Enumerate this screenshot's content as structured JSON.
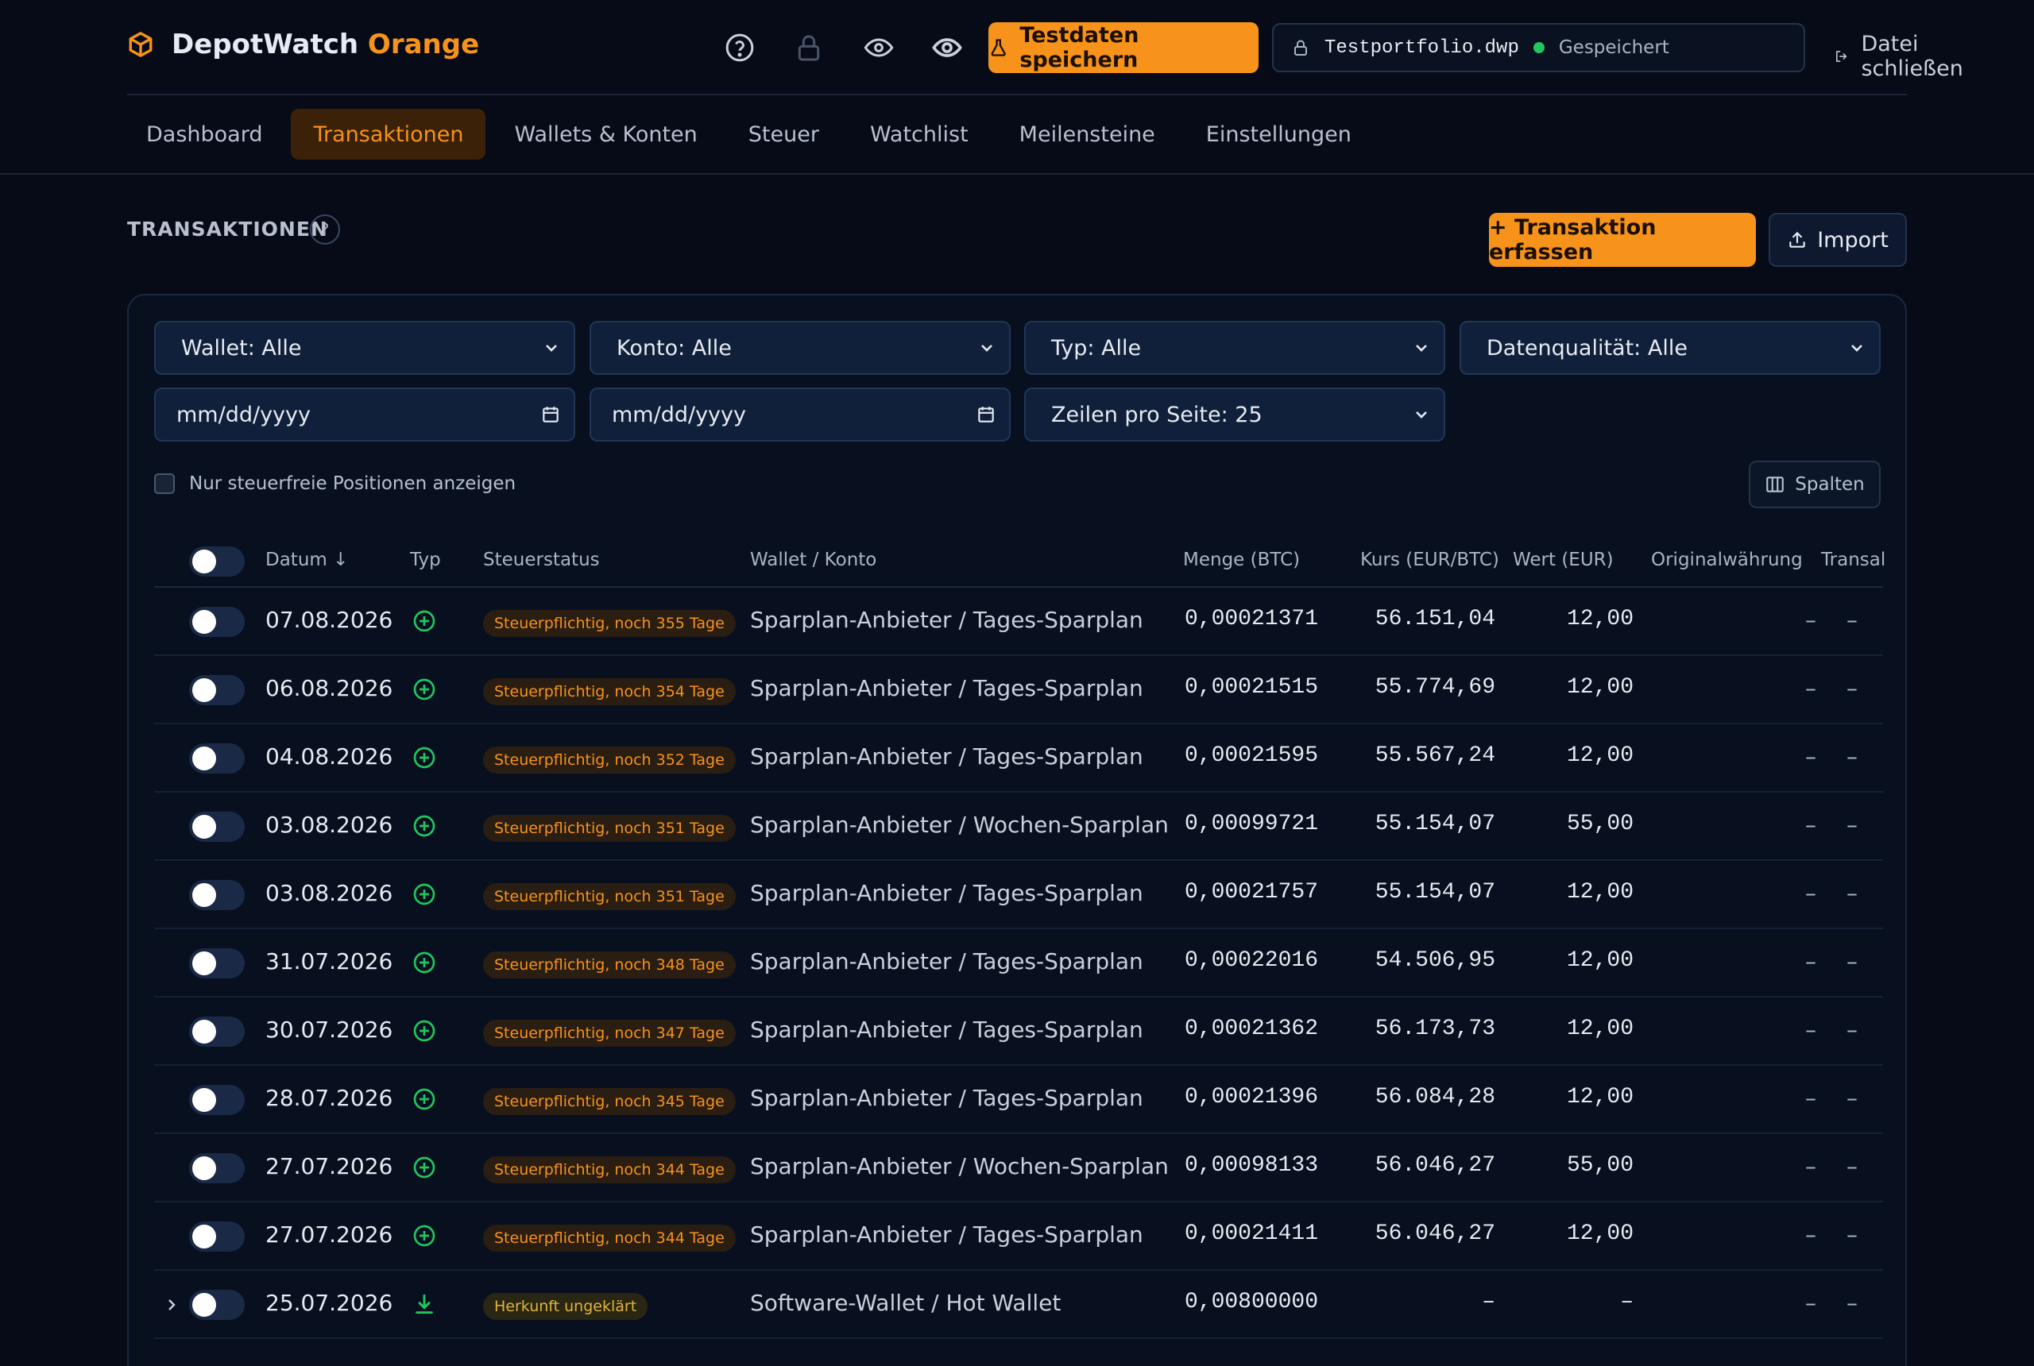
{
  "header": {
    "brand_main": "DepotWatch",
    "brand_accent": "Orange",
    "test_button": "Testdaten speichern",
    "file_name": "Testportfolio.dwp",
    "file_status": "Gespeichert",
    "close_file": "Datei schließen",
    "icons": [
      "help-icon",
      "lock-icon",
      "eye-icon",
      "eye-icon"
    ]
  },
  "tabs": [
    {
      "label": "Dashboard",
      "active": false
    },
    {
      "label": "Transaktionen",
      "active": true
    },
    {
      "label": "Wallets & Konten",
      "active": false
    },
    {
      "label": "Steuer",
      "active": false
    },
    {
      "label": "Watchlist",
      "active": false
    },
    {
      "label": "Meilensteine",
      "active": false
    },
    {
      "label": "Einstellungen",
      "active": false
    }
  ],
  "section": {
    "title": "TRANSAKTIONEN",
    "help": "?",
    "add_button": "+ Transaktion erfassen",
    "import_button": "Import"
  },
  "filters": {
    "wallet": "Wallet: Alle",
    "konto": "Konto: Alle",
    "typ": "Typ: Alle",
    "quality": "Datenqualität: Alle",
    "date_from": "mm/dd/yyyy",
    "date_to": "mm/dd/yyyy",
    "rows_per_page": "Zeilen pro Seite: 25",
    "taxfree_only": "Nur steuerfreie Positionen anzeigen",
    "columns_button": "Spalten"
  },
  "table": {
    "columns": {
      "datum": "Datum ↓",
      "typ": "Typ",
      "steuerstatus": "Steuerstatus",
      "wallet": "Wallet / Konto",
      "menge": "Menge (BTC)",
      "kurs": "Kurs (EUR/BTC)",
      "wert": "Wert (EUR)",
      "orig": "Originalwährung",
      "trans": "Transal"
    },
    "rows": [
      {
        "datum": "07.08.2026",
        "type": "buy",
        "status": "Steuerpflichtig, noch 355 Tage",
        "status_kind": "tax",
        "wallet": "Sparplan-Anbieter / Tages-Sparplan",
        "menge": "0,00021371",
        "kurs": "56.151,04",
        "wert": "12,00",
        "orig": "–",
        "trans": "–"
      },
      {
        "datum": "06.08.2026",
        "type": "buy",
        "status": "Steuerpflichtig, noch 354 Tage",
        "status_kind": "tax",
        "wallet": "Sparplan-Anbieter / Tages-Sparplan",
        "menge": "0,00021515",
        "kurs": "55.774,69",
        "wert": "12,00",
        "orig": "–",
        "trans": "–"
      },
      {
        "datum": "04.08.2026",
        "type": "buy",
        "status": "Steuerpflichtig, noch 352 Tage",
        "status_kind": "tax",
        "wallet": "Sparplan-Anbieter / Tages-Sparplan",
        "menge": "0,00021595",
        "kurs": "55.567,24",
        "wert": "12,00",
        "orig": "–",
        "trans": "–"
      },
      {
        "datum": "03.08.2026",
        "type": "buy",
        "status": "Steuerpflichtig, noch 351 Tage",
        "status_kind": "tax",
        "wallet": "Sparplan-Anbieter / Wochen-Sparplan",
        "menge": "0,00099721",
        "kurs": "55.154,07",
        "wert": "55,00",
        "orig": "–",
        "trans": "–"
      },
      {
        "datum": "03.08.2026",
        "type": "buy",
        "status": "Steuerpflichtig, noch 351 Tage",
        "status_kind": "tax",
        "wallet": "Sparplan-Anbieter / Tages-Sparplan",
        "menge": "0,00021757",
        "kurs": "55.154,07",
        "wert": "12,00",
        "orig": "–",
        "trans": "–"
      },
      {
        "datum": "31.07.2026",
        "type": "buy",
        "status": "Steuerpflichtig, noch 348 Tage",
        "status_kind": "tax",
        "wallet": "Sparplan-Anbieter / Tages-Sparplan",
        "menge": "0,00022016",
        "kurs": "54.506,95",
        "wert": "12,00",
        "orig": "–",
        "trans": "–"
      },
      {
        "datum": "30.07.2026",
        "type": "buy",
        "status": "Steuerpflichtig, noch 347 Tage",
        "status_kind": "tax",
        "wallet": "Sparplan-Anbieter / Tages-Sparplan",
        "menge": "0,00021362",
        "kurs": "56.173,73",
        "wert": "12,00",
        "orig": "–",
        "trans": "–"
      },
      {
        "datum": "28.07.2026",
        "type": "buy",
        "status": "Steuerpflichtig, noch 345 Tage",
        "status_kind": "tax",
        "wallet": "Sparplan-Anbieter / Tages-Sparplan",
        "menge": "0,00021396",
        "kurs": "56.084,28",
        "wert": "12,00",
        "orig": "–",
        "trans": "–"
      },
      {
        "datum": "27.07.2026",
        "type": "buy",
        "status": "Steuerpflichtig, noch 344 Tage",
        "status_kind": "tax",
        "wallet": "Sparplan-Anbieter / Wochen-Sparplan",
        "menge": "0,00098133",
        "kurs": "56.046,27",
        "wert": "55,00",
        "orig": "–",
        "trans": "–"
      },
      {
        "datum": "27.07.2026",
        "type": "buy",
        "status": "Steuerpflichtig, noch 344 Tage",
        "status_kind": "tax",
        "wallet": "Sparplan-Anbieter / Tages-Sparplan",
        "menge": "0,00021411",
        "kurs": "56.046,27",
        "wert": "12,00",
        "orig": "–",
        "trans": "–"
      },
      {
        "datum": "25.07.2026",
        "type": "receive",
        "status": "Herkunft ungeklärt",
        "status_kind": "unk",
        "wallet": "Software-Wallet / Hot Wallet",
        "menge": "0,00800000",
        "kurs": "–",
        "wert": "–",
        "orig": "–",
        "trans": "–",
        "expandable": true
      }
    ]
  },
  "colors": {
    "accent": "#f7931a",
    "background": "#060b17",
    "success": "#22c55e"
  }
}
